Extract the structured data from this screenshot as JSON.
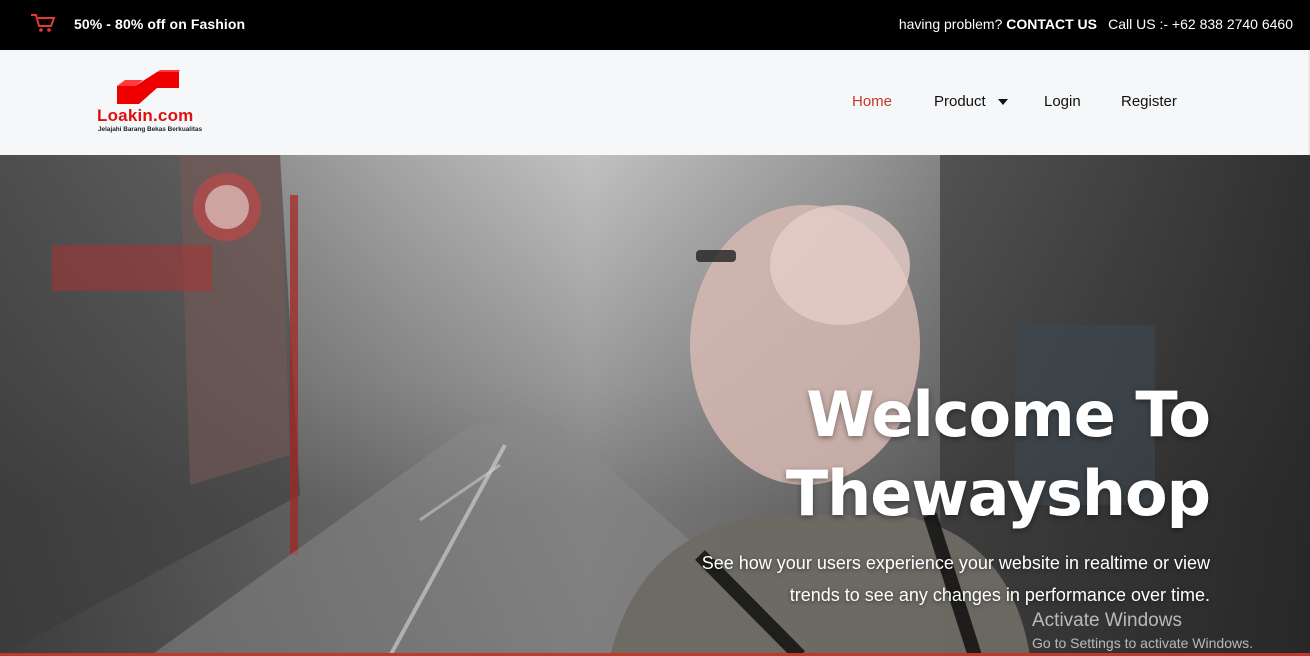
{
  "topbar": {
    "promo": "50% - 80% off on Fashion",
    "help_prefix": "having problem?",
    "help_link": "CONTACT US",
    "call": "Call US :- +62 838 2740 6460",
    "cart_icon": "cart-icon"
  },
  "header": {
    "logo_text": "Loakin.com",
    "logo_tagline": "Jelajahi Barang Bekas Berkualitas",
    "nav": {
      "home": "Home",
      "product": "Product",
      "login": "Login",
      "register": "Register"
    },
    "accent_color": "#c0392b"
  },
  "hero": {
    "title_line1": "Welcome To",
    "title_line2": "Thewayshop",
    "subtitle_line1": "See how your users experience your website in realtime or view",
    "subtitle_line2": "trends to see any changes in performance over time."
  },
  "watermark": {
    "line1": "Activate Windows",
    "line2": "Go to Settings to activate Windows."
  }
}
